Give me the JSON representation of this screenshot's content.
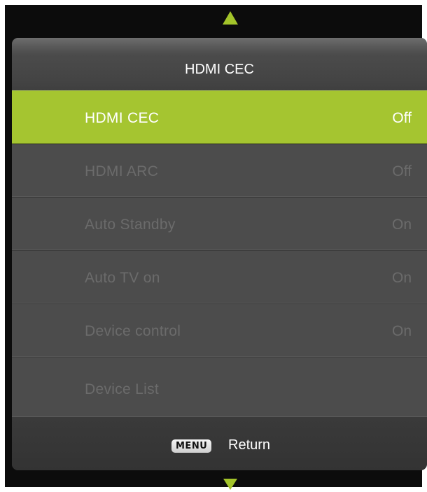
{
  "header": {
    "title": "HDMI CEC"
  },
  "menu": {
    "items": [
      {
        "label": "HDMI CEC",
        "value": "Off",
        "selected": true
      },
      {
        "label": "HDMI ARC",
        "value": "Off",
        "selected": false
      },
      {
        "label": "Auto Standby",
        "value": "On",
        "selected": false
      },
      {
        "label": "Auto TV on",
        "value": "On",
        "selected": false
      },
      {
        "label": "Device control",
        "value": "On",
        "selected": false
      },
      {
        "label": "Device List",
        "value": "",
        "selected": false
      }
    ]
  },
  "footer": {
    "key_label": "MENU",
    "action_label": "Return"
  },
  "icons": {
    "scroll_up": "triangle-up-icon",
    "scroll_down": "triangle-down-icon"
  },
  "colors": {
    "accent": "#a5c530",
    "panel": "#4c4c4c",
    "disabled_text": "#6b6b6b"
  }
}
